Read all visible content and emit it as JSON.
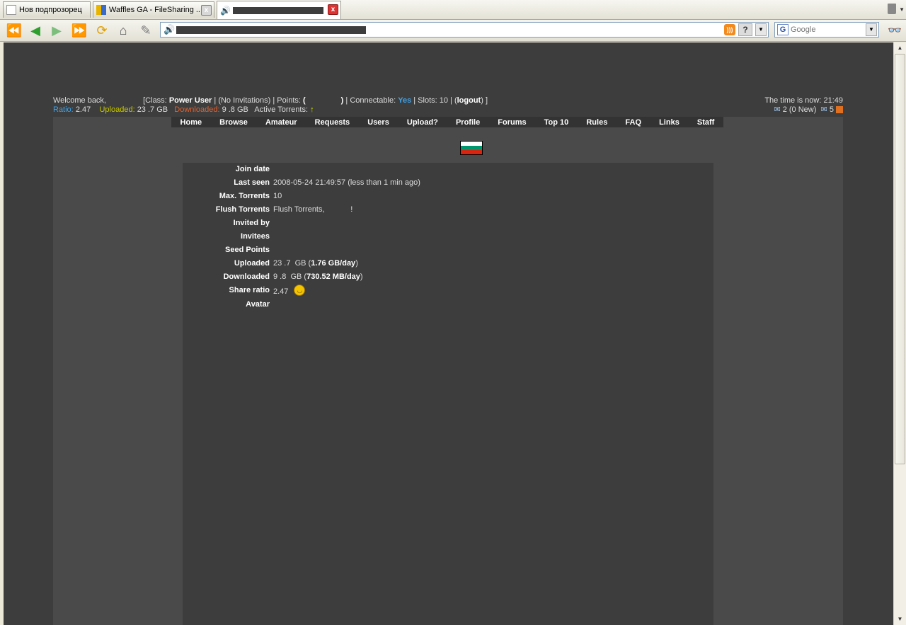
{
  "tabs": [
    {
      "title": "Нов подпрозорец",
      "active": false
    },
    {
      "title": "Waffles GA - FileSharing ...",
      "active": false
    },
    {
      "title": "",
      "active": true
    }
  ],
  "search": {
    "placeholder": "Google"
  },
  "userbar": {
    "welcome": "Welcome back,",
    "class_label": "[Class:",
    "class_value": "Power User",
    "invitations": "(No Invitations)",
    "points_label": "Points:",
    "points_open": "(",
    "points_close": ")",
    "connectable_label": "Connectable:",
    "connectable_value": "Yes",
    "slots": "Slots: 10",
    "logout": "logout",
    "ratio_label": "Ratio:",
    "ratio_value": "2.47",
    "uploaded_label": "Uploaded:",
    "uploaded_value": "23 .7  GB",
    "downloaded_label": "Downloaded:",
    "downloaded_value": "9 .8  GB",
    "active_torrents_label": "Active Torrents:",
    "time": "The time is now: 21:49",
    "messages": "2 (0 New)",
    "sent_count": "5"
  },
  "menu": [
    "Home",
    "Browse",
    "Amateur",
    "Requests",
    "Users",
    "Upload?",
    "Profile",
    "Forums",
    "Top 10",
    "Rules",
    "FAQ",
    "Links",
    "Staff"
  ],
  "flag": {
    "colors": [
      "#ffffff",
      "#00966e",
      "#d62612"
    ]
  },
  "details": [
    {
      "label": "Join date",
      "value": "",
      "bold": ""
    },
    {
      "label": "Last seen",
      "value": "2008-05-24 21:49:57 (less than 1 min ago)",
      "bold": ""
    },
    {
      "label": "Max. Torrents",
      "value": "10",
      "bold": ""
    },
    {
      "label": "Flush Torrents",
      "value": "Flush Torrents,            !",
      "bold": ""
    },
    {
      "label": "Invited by",
      "value": "",
      "bold": ""
    },
    {
      "label": "Invitees",
      "value": "",
      "bold": ""
    },
    {
      "label": "Seed Points",
      "value": "",
      "bold": ""
    },
    {
      "label": "Uploaded",
      "value": "23 .7  GB (",
      "bold": "1.76 GB/day",
      "tail": ")"
    },
    {
      "label": "Downloaded",
      "value": "9 .8  GB (",
      "bold": "730.52 MB/day",
      "tail": ")"
    },
    {
      "label": "Share ratio",
      "value": "2.47",
      "bold": "",
      "smiley": "laughing-smiley-icon"
    },
    {
      "label": "Avatar",
      "value": "",
      "bold": ""
    }
  ]
}
